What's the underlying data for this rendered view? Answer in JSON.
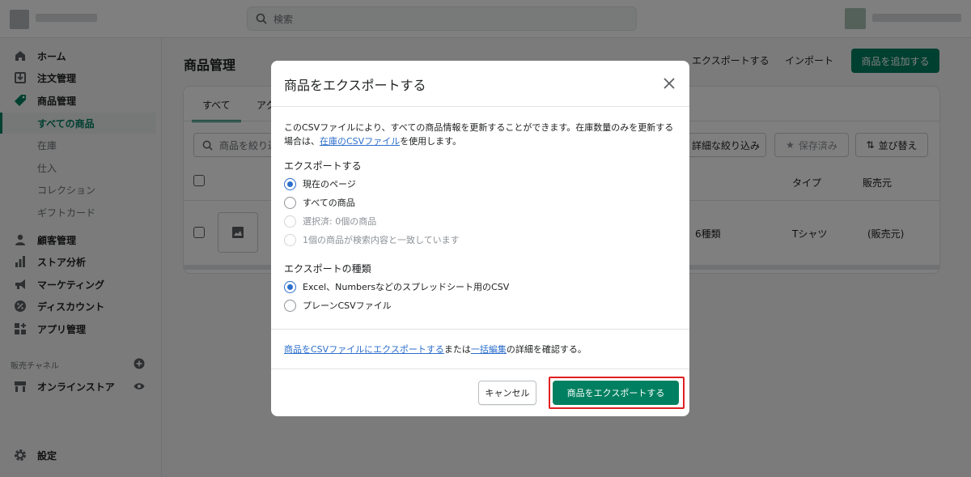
{
  "topbar": {
    "search_placeholder": "検索"
  },
  "sidebar": {
    "items": [
      {
        "label": "ホーム",
        "icon": "home-icon"
      },
      {
        "label": "注文管理",
        "icon": "orders-icon"
      },
      {
        "label": "商品管理",
        "icon": "tag-icon"
      }
    ],
    "product_sub": [
      "すべての商品",
      "在庫",
      "仕入",
      "コレクション",
      "ギフトカード"
    ],
    "items2": [
      {
        "label": "顧客管理",
        "icon": "person-icon"
      },
      {
        "label": "ストア分析",
        "icon": "analytics-icon"
      },
      {
        "label": "マーケティング",
        "icon": "megaphone-icon"
      },
      {
        "label": "ディスカウント",
        "icon": "discount-icon"
      },
      {
        "label": "アプリ管理",
        "icon": "apps-icon"
      }
    ],
    "sales_channel_label": "販売チャネル",
    "online_store": "オンラインストア",
    "settings": "設定"
  },
  "main": {
    "title": "商品管理",
    "export_link": "エクスポートする",
    "import_link": "インポート",
    "add_product": "商品を追加する",
    "tabs": [
      "すべて",
      "アク"
    ],
    "filter_placeholder": "商品を絞り込",
    "detail_filter": "詳細な絞り込み",
    "saved": "保存済み",
    "sort": "並び替え",
    "columns": {
      "type": "タイプ",
      "vendor": "販売元"
    },
    "row": {
      "variants": "：6種類",
      "type": "Tシャツ",
      "vendor": "(販売元)"
    }
  },
  "modal": {
    "title": "商品をエクスポートする",
    "desc_part1": "このCSVファイルにより、すべての商品情報を更新することができます。在庫数量のみを更新する場合は、",
    "desc_link": "在庫のCSVファイル",
    "desc_part2": "を使用します。",
    "export_group_label": "エクスポートする",
    "export_options": [
      "現在のページ",
      "すべての商品",
      "選択済: 0個の商品",
      "1個の商品が検索内容と一致しています"
    ],
    "type_group_label": "エクスポートの種類",
    "type_options": [
      "Excel、Numbersなどのスプレッドシート用のCSV",
      "プレーンCSVファイル"
    ],
    "help_link1": "商品をCSVファイルにエクスポートする",
    "help_mid": "または",
    "help_link2": "一括編集",
    "help_end": "の詳細を確認する。",
    "cancel": "キャンセル",
    "export_button": "商品をエクスポートする"
  }
}
